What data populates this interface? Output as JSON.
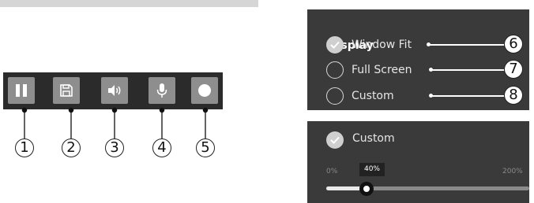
{
  "toolbar": {
    "buttons": [
      {
        "icon": "pause-icon",
        "callout": "1"
      },
      {
        "icon": "save-icon",
        "callout": "2"
      },
      {
        "icon": "speaker-icon",
        "callout": "3"
      },
      {
        "icon": "microphone-icon",
        "callout": "4"
      },
      {
        "icon": "record-icon",
        "callout": "5"
      }
    ]
  },
  "display": {
    "title": "Display",
    "options": [
      {
        "label": "Window Fit",
        "checked": true,
        "callout": "6"
      },
      {
        "label": "Full Screen",
        "checked": false,
        "callout": "7"
      },
      {
        "label": "Custom",
        "checked": false,
        "callout": "8"
      }
    ]
  },
  "custom": {
    "label": "Custom",
    "checked": true,
    "min_label": "0%",
    "max_label": "200%",
    "value_label": "40%",
    "value_fraction": 0.2
  },
  "colors": {
    "toolbar_bg": "#2b2b2b",
    "button_bg": "#8e8e8e",
    "panel_bg": "#3a3a3a"
  }
}
